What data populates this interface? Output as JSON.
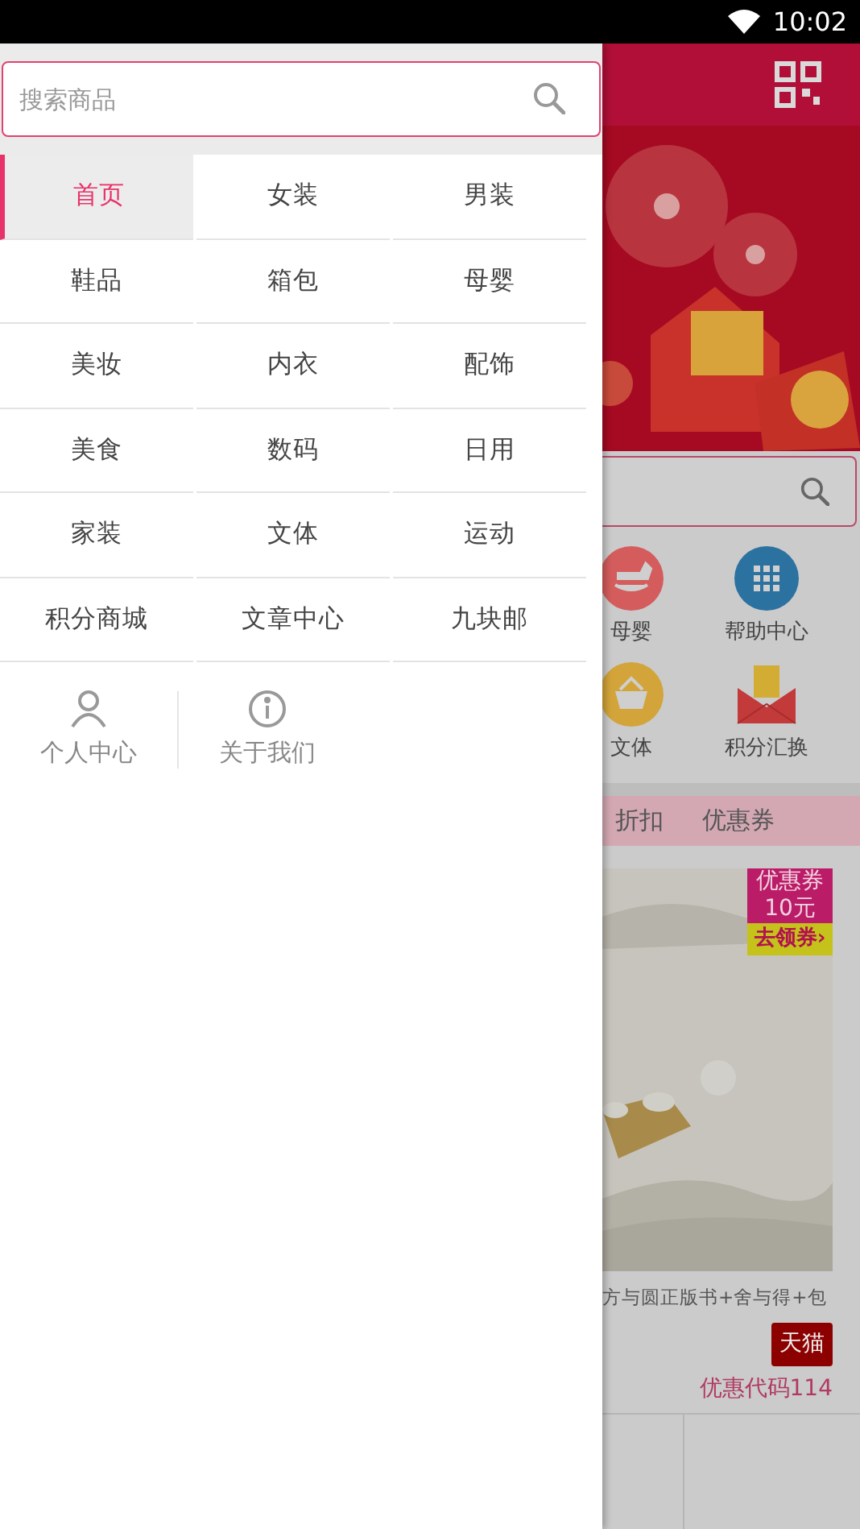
{
  "status_bar": {
    "time": "10:02"
  },
  "drawer": {
    "search": {
      "placeholder": "搜索商品"
    },
    "categories": [
      {
        "label": "首页",
        "selected": true
      },
      {
        "label": "女装",
        "selected": false
      },
      {
        "label": "男装",
        "selected": false
      },
      {
        "label": "鞋品",
        "selected": false
      },
      {
        "label": "箱包",
        "selected": false
      },
      {
        "label": "母婴",
        "selected": false
      },
      {
        "label": "美妆",
        "selected": false
      },
      {
        "label": "内衣",
        "selected": false
      },
      {
        "label": "配饰",
        "selected": false
      },
      {
        "label": "美食",
        "selected": false
      },
      {
        "label": "数码",
        "selected": false
      },
      {
        "label": "日用",
        "selected": false
      },
      {
        "label": "家装",
        "selected": false
      },
      {
        "label": "文体",
        "selected": false
      },
      {
        "label": "运动",
        "selected": false
      },
      {
        "label": "积分商城",
        "selected": false
      },
      {
        "label": "文章中心",
        "selected": false
      },
      {
        "label": "九块邮",
        "selected": false
      }
    ],
    "links": [
      {
        "label": "个人中心",
        "kind": "person"
      },
      {
        "label": "关于我们",
        "kind": "info"
      }
    ]
  },
  "app": {
    "shortcuts": [
      {
        "label": "母婴",
        "kind": "horse"
      },
      {
        "label": "帮助中心",
        "kind": "grid"
      },
      {
        "label": "文体",
        "kind": "basket"
      },
      {
        "label": "积分汇换",
        "kind": "envelope"
      }
    ],
    "tabs": [
      {
        "label": "折扣"
      },
      {
        "label": "优惠券"
      }
    ],
    "product": {
      "coupon": {
        "title": "优惠券",
        "amount": "10元",
        "action": "去领券›"
      },
      "title": "方与圆正版书+舍与得+包",
      "shop": "天猫",
      "code": "优惠代码114"
    }
  }
}
